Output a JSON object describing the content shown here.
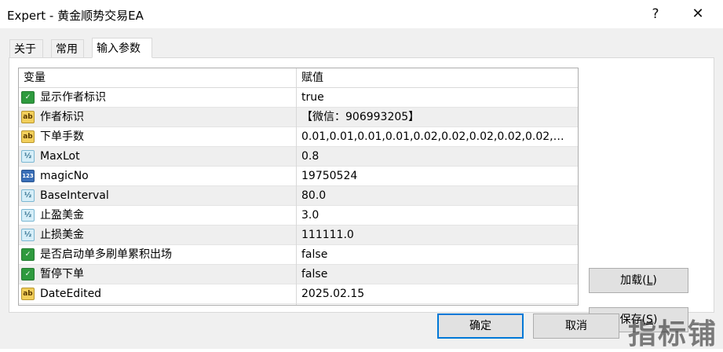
{
  "window": {
    "title": "Expert - 黄金顺势交易EA",
    "help_glyph": "?",
    "close_glyph": "✕"
  },
  "tabs": [
    {
      "label": "关于",
      "active": false
    },
    {
      "label": "常用",
      "active": false
    },
    {
      "label": "输入参数",
      "active": true
    }
  ],
  "grid": {
    "columns": [
      "变量",
      "赋值"
    ],
    "rows": [
      {
        "name": "显示作者标识",
        "value": "true",
        "type": "bool-icon"
      },
      {
        "name": "作者标识",
        "value": "【微信：906993205】",
        "type": "string-icon"
      },
      {
        "name": "下单手数",
        "value": "0.01,0.01,0.01,0.01,0.02,0.02,0.02,0.02,0.02,0...",
        "type": "string-icon"
      },
      {
        "name": "MaxLot",
        "value": "0.8",
        "type": "double-icon"
      },
      {
        "name": "magicNo",
        "value": "19750524",
        "type": "integer-icon"
      },
      {
        "name": "BaseInterval",
        "value": "80.0",
        "type": "double-icon"
      },
      {
        "name": "止盈美金",
        "value": "3.0",
        "type": "double-icon"
      },
      {
        "name": "止损美金",
        "value": "111111.0",
        "type": "double-icon"
      },
      {
        "name": "是否启动单多刷单累积出场",
        "value": "false",
        "type": "bool-icon"
      },
      {
        "name": "暂停下单",
        "value": "false",
        "type": "bool-icon"
      },
      {
        "name": "DateEdited",
        "value": "2025.02.15",
        "type": "string-icon"
      }
    ]
  },
  "icon_glyphs": {
    "bool-icon": "✓",
    "string-icon": "ab",
    "double-icon": "½",
    "integer-icon": "123"
  },
  "side_buttons": {
    "load": {
      "label": "加载(",
      "hotkey": "L",
      "end": ")"
    },
    "save": {
      "label": "保存(",
      "hotkey": "S",
      "end": ")"
    }
  },
  "dialog_buttons": {
    "ok": "确定",
    "cancel": "取消"
  },
  "watermark": "指标铺",
  "colors": {
    "accent": "#0078d7",
    "alt_row": "#efefef",
    "bool_icon": "#2e9a3e",
    "string_icon": "#f2cf5b"
  }
}
